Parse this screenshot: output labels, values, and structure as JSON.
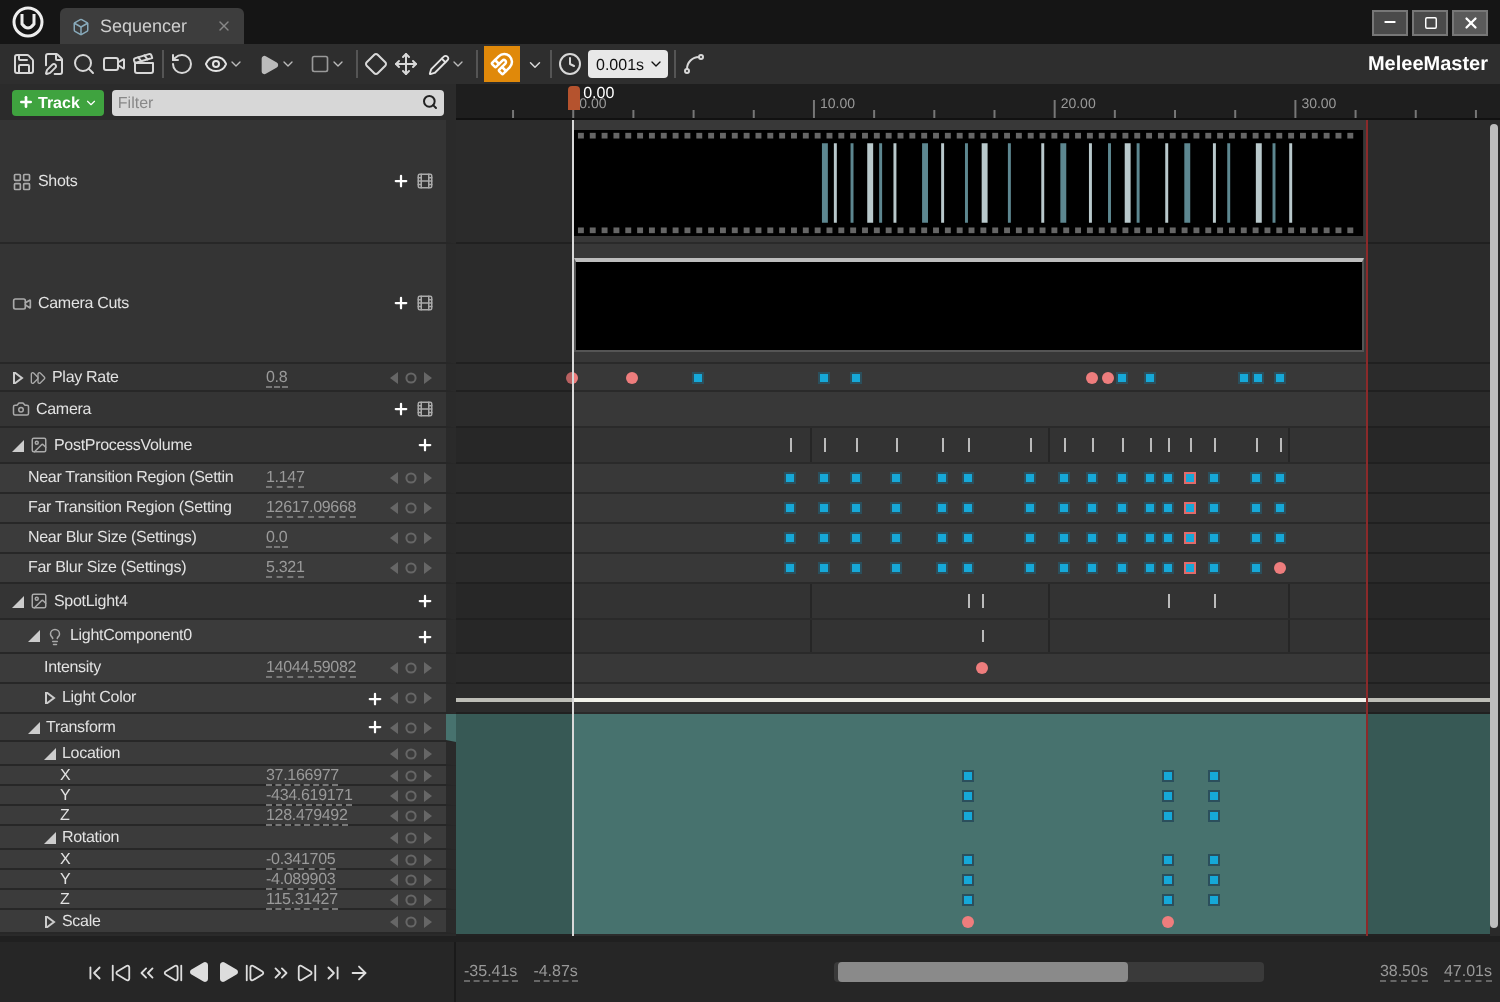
{
  "window": {
    "tab_title": "Sequencer"
  },
  "toolbar": {
    "snap_enabled": true,
    "time_step": "0.001s",
    "sequence_name": "MeleeMaster"
  },
  "track_button": "Track",
  "filter": {
    "placeholder": "Filter"
  },
  "ruler": {
    "playhead_label": "0.00",
    "labels": [
      "0.00",
      "10.00",
      "20.00",
      "30.00"
    ]
  },
  "tracks": [
    {
      "kind": "shots",
      "label": "Shots",
      "selected": false
    },
    {
      "kind": "camera_cuts",
      "label": "Camera Cuts",
      "selected": false
    },
    {
      "kind": "play_rate",
      "label": "Play Rate",
      "value": "0.8",
      "expanded": false,
      "selected": false
    },
    {
      "kind": "camera",
      "label": "Camera",
      "selected": false
    },
    {
      "kind": "actor",
      "label": "PostProcessVolume",
      "expanded": true,
      "selected": false,
      "children": [
        {
          "kind": "property",
          "label": "Near Transition Region (Settin",
          "value": "1.147",
          "selected": false
        },
        {
          "kind": "property",
          "label": "Far Transition Region (Setting",
          "value": "12617.09668",
          "selected": false
        },
        {
          "kind": "property",
          "label": "Near Blur Size (Settings)",
          "value": "0.0",
          "selected": false
        },
        {
          "kind": "property",
          "label": "Far Blur Size (Settings)",
          "value": "5.321",
          "selected": false
        }
      ]
    },
    {
      "kind": "actor",
      "label": "SpotLight4",
      "expanded": true,
      "selected": false,
      "children": [
        {
          "kind": "component",
          "label": "LightComponent0",
          "expanded": true,
          "selected": false,
          "children": [
            {
              "kind": "property",
              "label": "Intensity",
              "value": "14044.59082",
              "selected": false
            },
            {
              "kind": "color",
              "label": "Light Color",
              "expanded": false,
              "selected": false
            }
          ]
        },
        {
          "kind": "transform",
          "label": "Transform",
          "expanded": true,
          "selected": true,
          "children": [
            {
              "kind": "group",
              "label": "Location",
              "expanded": true,
              "selected": false,
              "children": [
                {
                  "kind": "channel",
                  "label": "X",
                  "value": "37.166977",
                  "selected": false
                },
                {
                  "kind": "channel",
                  "label": "Y",
                  "value": "-434.619171",
                  "selected": false
                },
                {
                  "kind": "channel",
                  "label": "Z",
                  "value": "128.479492",
                  "selected": false
                }
              ]
            },
            {
              "kind": "group",
              "label": "Rotation",
              "expanded": true,
              "selected": false,
              "children": [
                {
                  "kind": "channel",
                  "label": "X",
                  "value": "-0.341705",
                  "selected": false
                },
                {
                  "kind": "channel",
                  "label": "Y",
                  "value": "-4.089903",
                  "selected": false
                },
                {
                  "kind": "channel",
                  "label": "Z",
                  "value": "115.31427",
                  "selected": false
                }
              ]
            },
            {
              "kind": "group",
              "label": "Scale",
              "expanded": false,
              "selected": false
            }
          ]
        }
      ]
    }
  ],
  "ranges": {
    "working_start": "-35.41s",
    "view_start": "-4.87s",
    "view_end": "38.50s",
    "working_end": "47.01s"
  }
}
